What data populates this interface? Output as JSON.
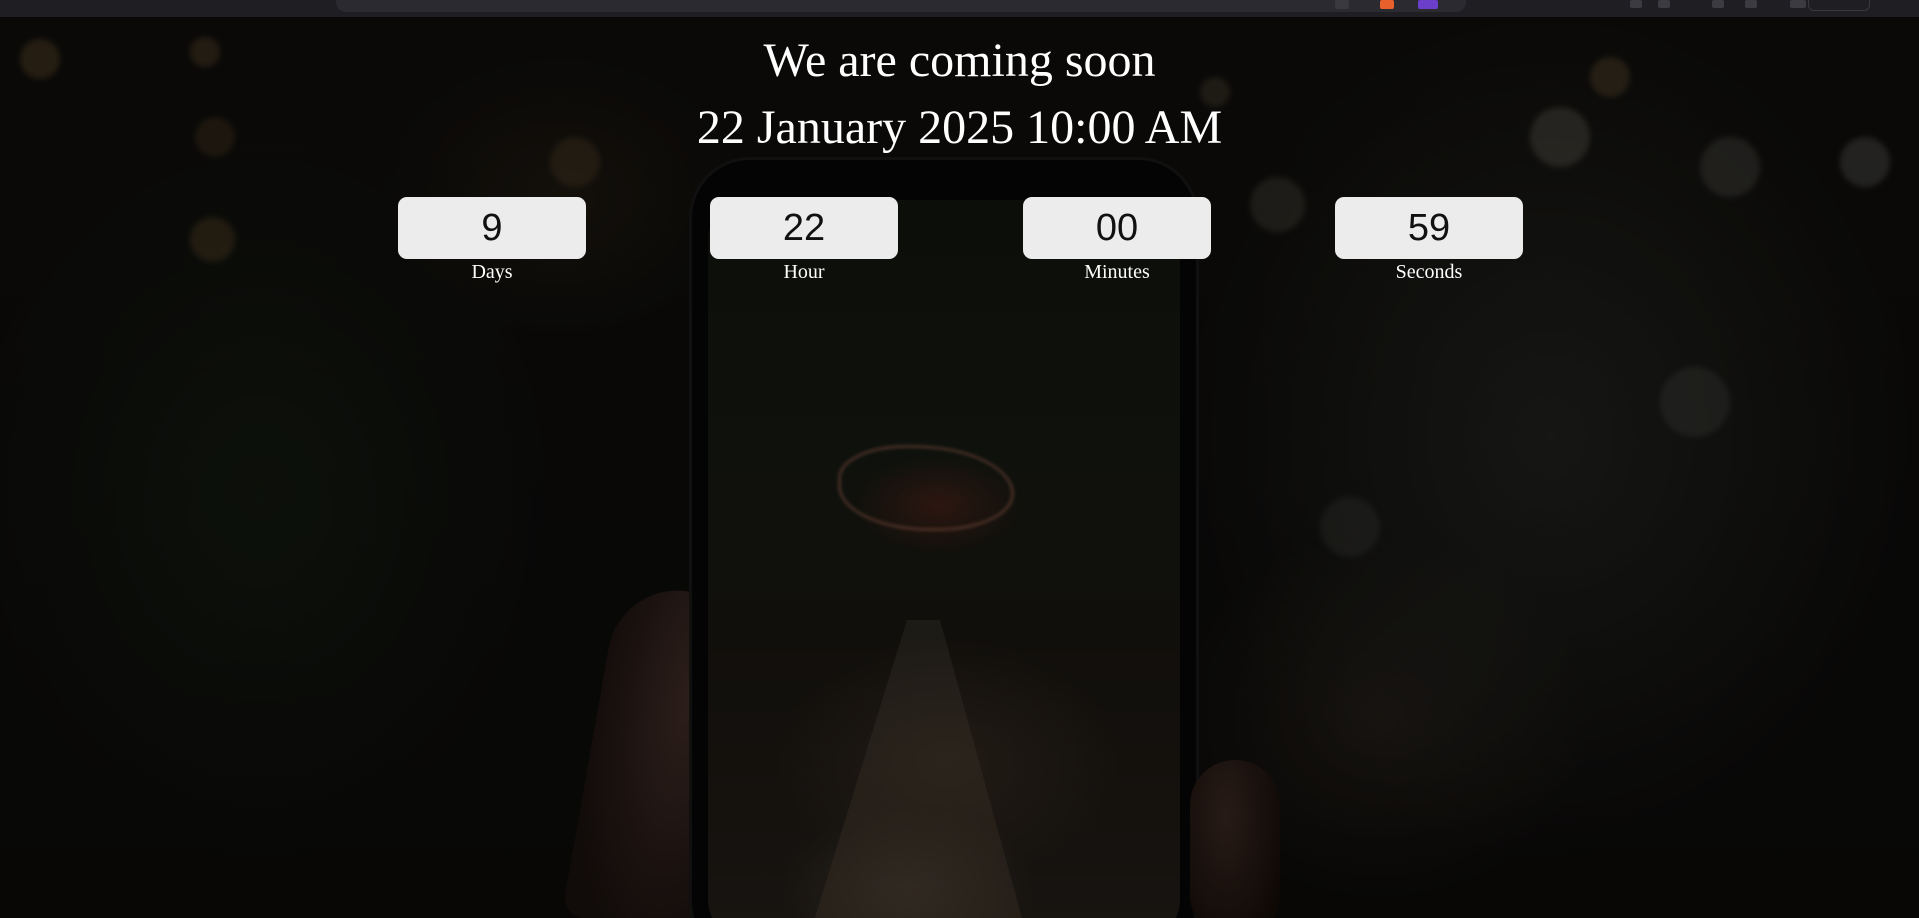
{
  "page": {
    "heading": "We are coming soon",
    "launch_date": "22 January 2025 10:00 AM"
  },
  "countdown": {
    "days": {
      "value": "9",
      "label": "Days"
    },
    "hours": {
      "value": "22",
      "label": "Hour"
    },
    "minutes": {
      "value": "00",
      "label": "Minutes"
    },
    "seconds": {
      "value": "59",
      "label": "Seconds"
    }
  },
  "colors": {
    "text": "#ffffff",
    "box_background": "#ececec",
    "box_text": "#111111",
    "overlay": "rgba(0,0,0,0.58)"
  }
}
